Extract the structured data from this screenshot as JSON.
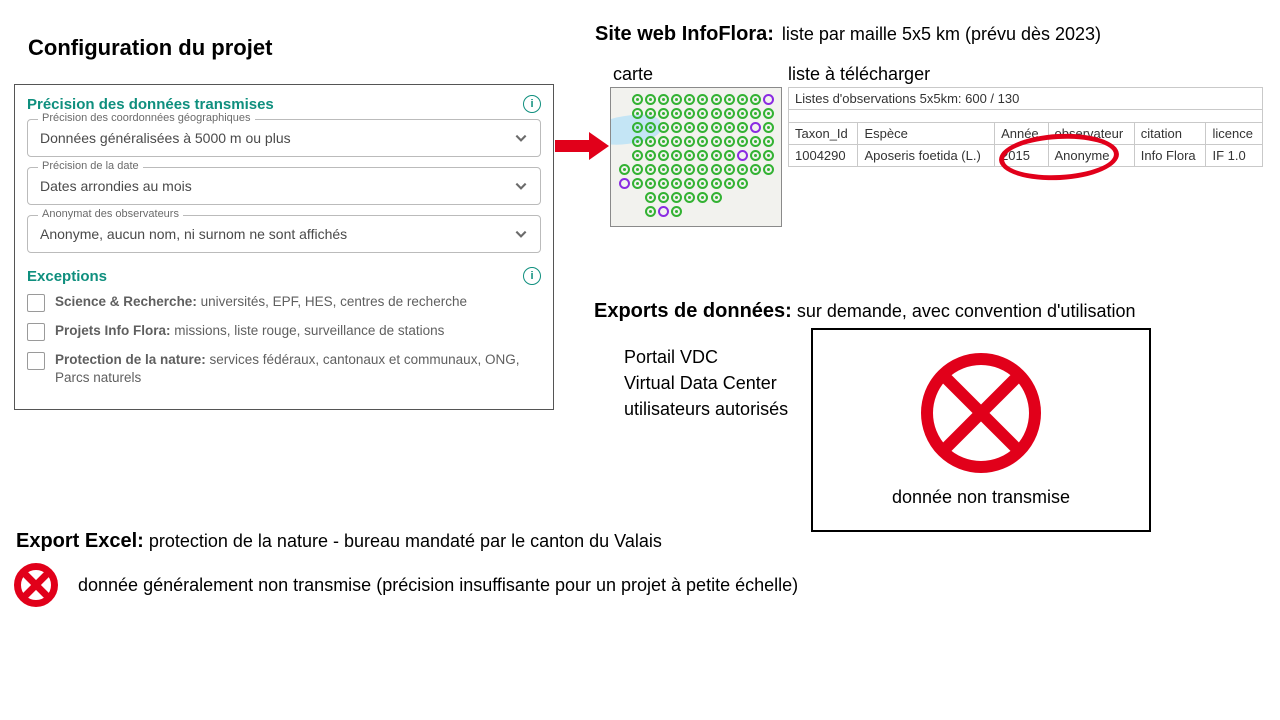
{
  "config": {
    "title": "Configuration du projet",
    "precision": {
      "section_title": "Précision des données transmises",
      "fields": [
        {
          "label": "Précision des coordonnées géographiques",
          "value": "Données généralisées à 5000 m ou plus"
        },
        {
          "label": "Précision de la date",
          "value": "Dates arrondies au mois"
        },
        {
          "label": "Anonymat des observateurs",
          "value": "Anonyme, aucun nom, ni surnom ne sont affichés"
        }
      ]
    },
    "exceptions": {
      "section_title": "Exceptions",
      "items": [
        {
          "label": "Science & Recherche:",
          "desc": "universités, EPF, HES, centres de recherche"
        },
        {
          "label": "Projets Info Flora:",
          "desc": "missions, liste rouge, surveillance de stations"
        },
        {
          "label": "Protection de la nature:",
          "desc": "services fédéraux, cantonaux et communaux, ONG, Parcs naturels"
        }
      ]
    }
  },
  "infoflora": {
    "title": "Site web InfoFlora:",
    "subtitle": "liste par maille 5x5 km (prévu dès 2023)",
    "map_label": "carte",
    "list_label": "liste à télécharger",
    "list_header": "Listes d'observations 5x5km:  600 / 130",
    "columns": [
      "Taxon_Id",
      "Espèce",
      "Année",
      "observateur",
      "citation",
      "licence"
    ],
    "row": [
      "1004290",
      "Aposeris foetida (L.)",
      "2015",
      "Anonyme",
      "Info Flora",
      "IF 1.0"
    ]
  },
  "exports": {
    "title": "Exports de données:",
    "subtitle": " sur demande, avec convention d'utilisation",
    "vdc": [
      "Portail VDC",
      "Virtual Data Center",
      "utilisateurs autorisés"
    ],
    "not_transmitted": "donnée non transmise"
  },
  "excel": {
    "title": "Export Excel:",
    "subtitle": " protection de la nature - bureau mandaté par le canton du Valais",
    "note": "donnée généralement non transmise (précision insuffisante pour un projet à petite échelle)"
  },
  "map_pattern": [
    "x g g g g g g g g g g p",
    "x g g g g g g g g g g g",
    "x g g g g g g g g g p g",
    "x g g g g g g g g g g g",
    "x g g g g g g g g p g g",
    "g g g g g g g g g g g g",
    "p g g g g g g g g g x x",
    "x x g g g g g g x x x x",
    "x x g p g x x x x x x x"
  ]
}
